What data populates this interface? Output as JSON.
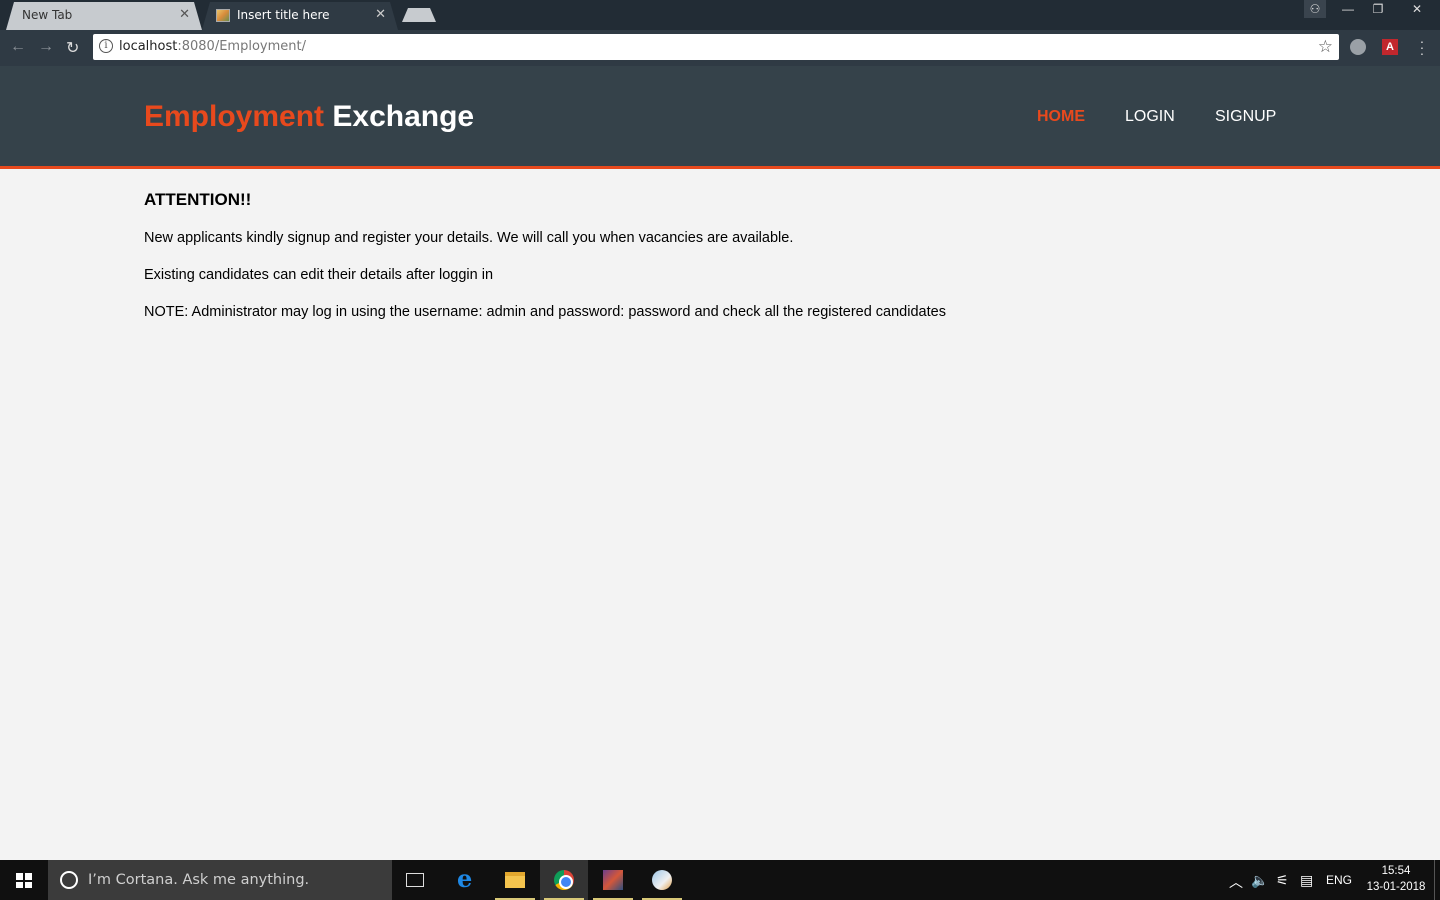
{
  "browser": {
    "tabs": [
      {
        "title": "New Tab",
        "active": false
      },
      {
        "title": "Insert title here",
        "active": true
      }
    ],
    "url_host": "localhost",
    "url_rest": ":8080/Employment/"
  },
  "header": {
    "brand_highlight": "Employment",
    "brand_rest": "Exchange",
    "nav": [
      {
        "label": "HOME",
        "active": true
      },
      {
        "label": "LOGIN",
        "active": false
      },
      {
        "label": "SIGNUP",
        "active": false
      }
    ]
  },
  "content": {
    "heading": "ATTENTION!!",
    "paragraphs": [
      "New applicants kindly signup and register your details. We will call you when vacancies are available.",
      "Existing candidates can edit their details after loggin in",
      "NOTE: Administrator may log in using the username: admin and password: password and check all the registered candidates"
    ]
  },
  "taskbar": {
    "cortana_placeholder": "I’m Cortana. Ask me anything.",
    "language": "ENG",
    "time": "15:54",
    "date": "13-01-2018"
  },
  "colors": {
    "accent": "#e8491d",
    "header_bg": "#35424a",
    "page_bg": "#f3f3f3"
  }
}
